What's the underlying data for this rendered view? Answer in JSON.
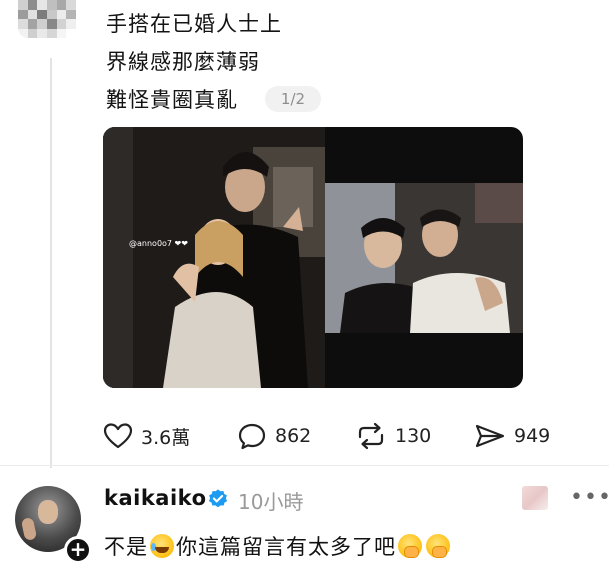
{
  "post": {
    "lines": [
      "手搭在已婚人士上",
      "界線感那麼薄弱",
      "難怪貴圈真亂"
    ],
    "page_indicator": "1/2",
    "story_tag": "@anno0o7 ❤❤"
  },
  "actions": {
    "likes": "3.6萬",
    "comments": "862",
    "reposts": "130",
    "shares": "949"
  },
  "reply": {
    "username": "kaikaiko",
    "timestamp": "10小時",
    "text_parts": [
      "不是",
      "你這篇留言有太多了吧"
    ],
    "emojis": [
      "face-with-tears-of-joy",
      "face-with-hand-over-mouth",
      "face-with-hand-over-mouth"
    ]
  },
  "icons": {
    "like": "heart-icon",
    "comment": "speech-bubble-icon",
    "repost": "repost-arrows-icon",
    "share": "paper-plane-icon",
    "verified": "verified-badge-icon",
    "more": "more-dots-icon",
    "follow": "plus-icon"
  },
  "colors": {
    "verified": "#1d9bf0",
    "muted_text": "#9a9a9a",
    "badge_bg": "#f1f1f1"
  }
}
